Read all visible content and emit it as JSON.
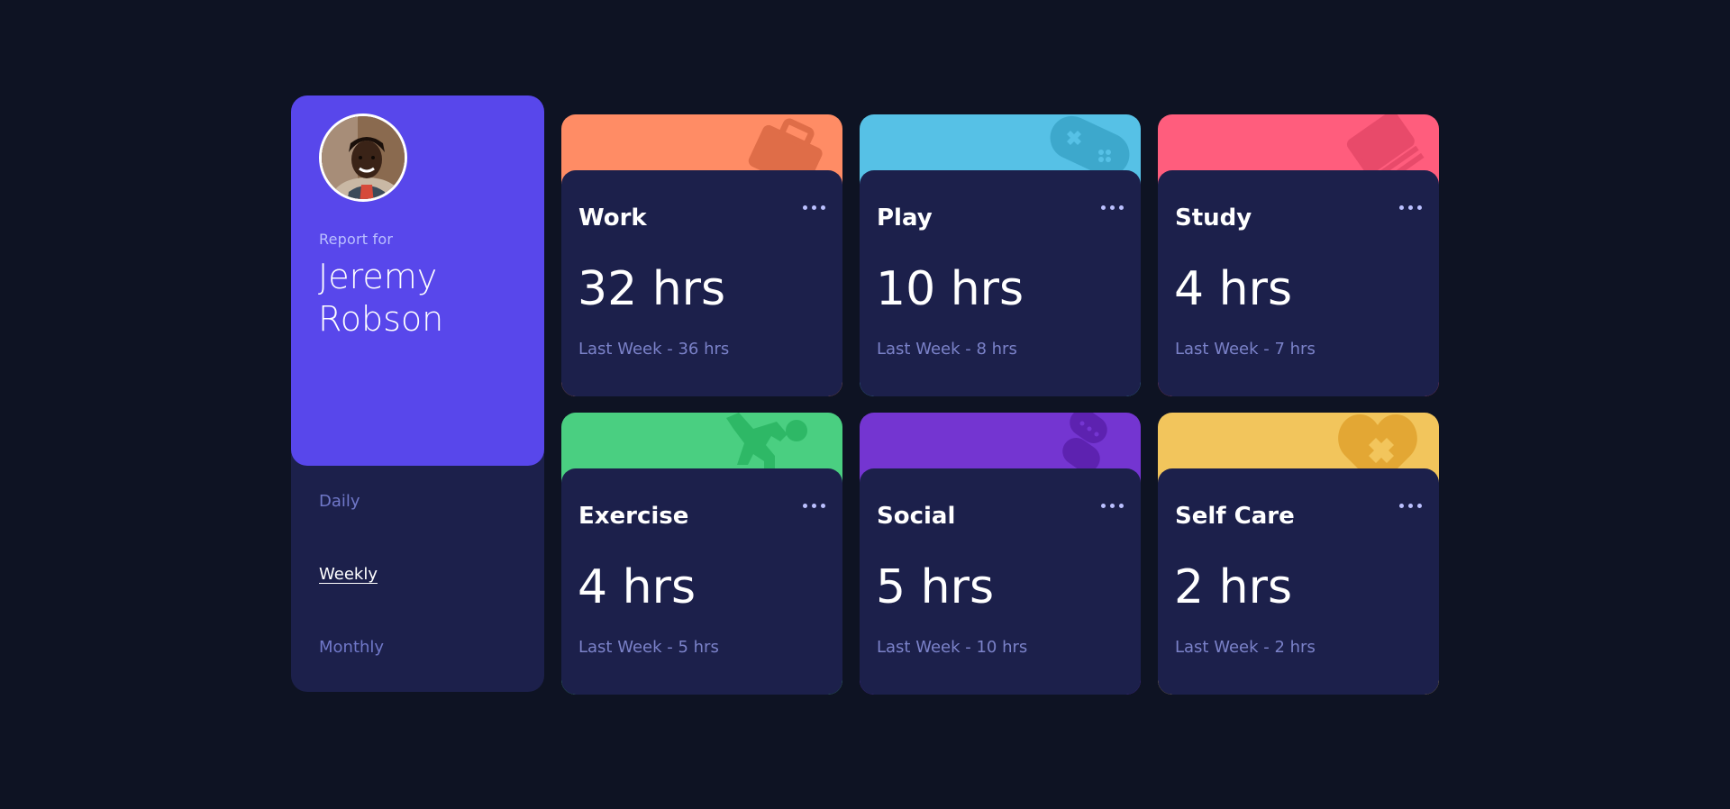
{
  "profile": {
    "report_for": "Report for",
    "name": "Jeremy Robson",
    "periods": [
      {
        "label": "Daily",
        "active": false
      },
      {
        "label": "Weekly",
        "active": true
      },
      {
        "label": "Monthly",
        "active": false
      }
    ]
  },
  "cards": [
    {
      "title": "Work",
      "current": "32 hrs",
      "previous": "Last Week - 36 hrs",
      "color": "#ff8c65",
      "icon": "briefcase-icon"
    },
    {
      "title": "Play",
      "current": "10 hrs",
      "previous": "Last Week - 8 hrs",
      "color": "#56c1e6",
      "icon": "gamepad-icon"
    },
    {
      "title": "Study",
      "current": "4 hrs",
      "previous": "Last Week - 7 hrs",
      "color": "#ff5d7d",
      "icon": "book-icon"
    },
    {
      "title": "Exercise",
      "current": "4 hrs",
      "previous": "Last Week - 5 hrs",
      "color": "#4acf81",
      "icon": "running-icon"
    },
    {
      "title": "Social",
      "current": "5 hrs",
      "previous": "Last Week - 10 hrs",
      "color": "#7435d1",
      "icon": "chat-icon"
    },
    {
      "title": "Self Care",
      "current": "2 hrs",
      "previous": "Last Week - 2 hrs",
      "color": "#f2c55c",
      "icon": "heart-icon"
    }
  ],
  "colors": {
    "background": "#0e1323",
    "card": "#1c204b",
    "profile_accent": "#5847eb",
    "muted_text": "#7078c9"
  }
}
